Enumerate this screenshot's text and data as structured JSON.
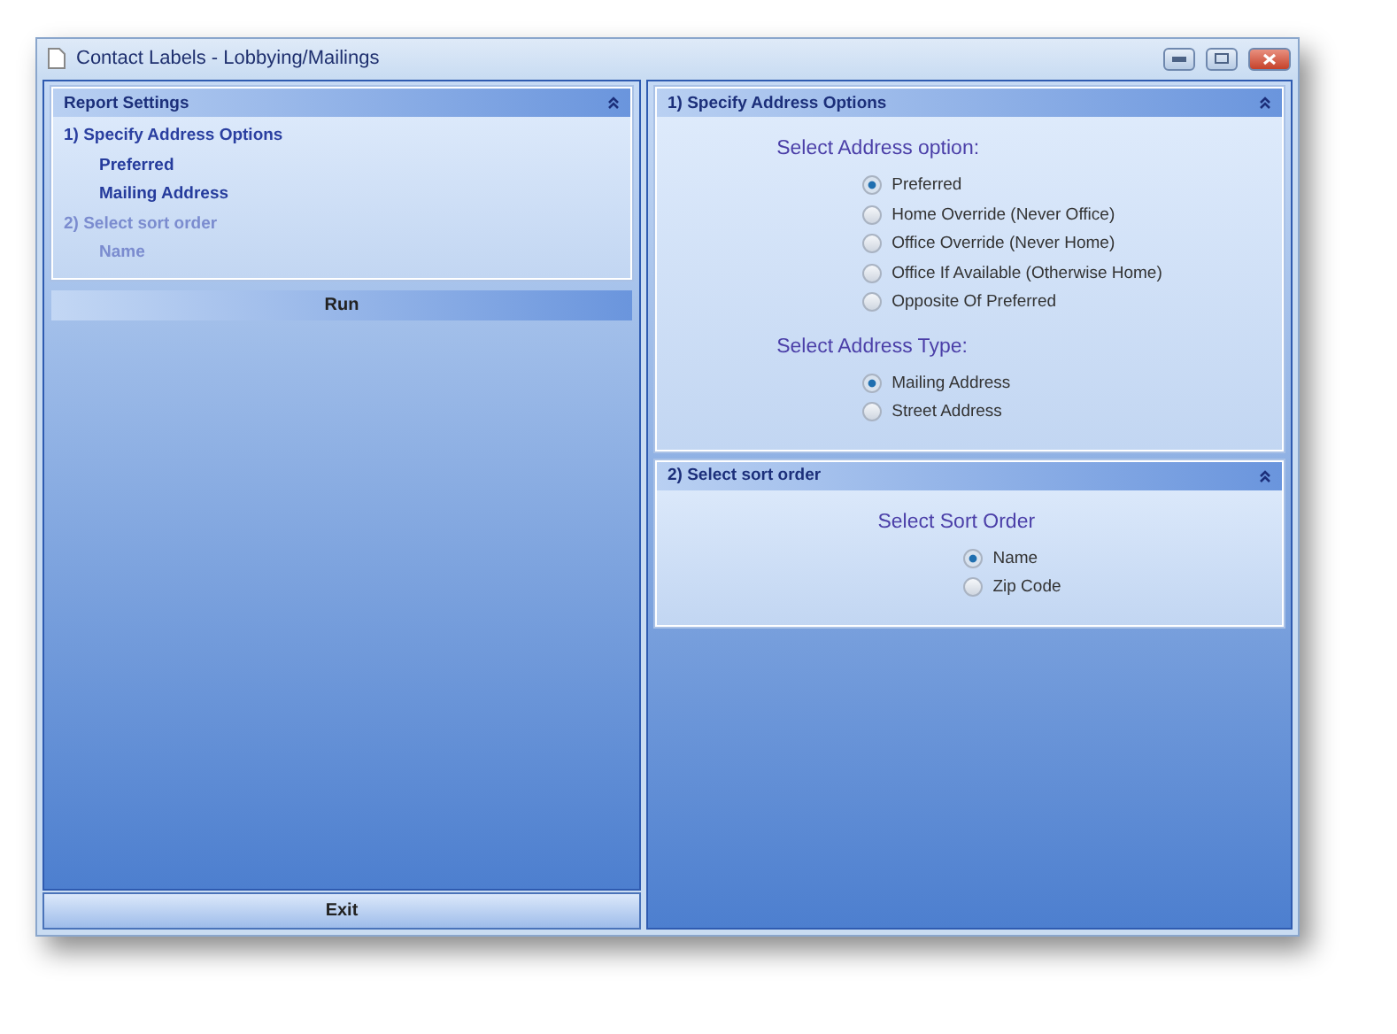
{
  "window": {
    "title": "Contact Labels - Lobbying/Mailings"
  },
  "report_settings": {
    "title": "Report Settings",
    "sections": [
      {
        "label": "1)  Specify Address Options",
        "active": true,
        "values": [
          "Preferred",
          "Mailing Address"
        ]
      },
      {
        "label": "2)  Select sort order",
        "active": false,
        "values": [
          "Name"
        ]
      }
    ],
    "run_button": "Run"
  },
  "exit_button": "Exit",
  "panels": [
    {
      "title": "1)  Specify Address Options",
      "groups": [
        {
          "heading": "Select Address option:",
          "options": [
            {
              "label": "Preferred",
              "selected": true
            },
            {
              "label": "Home Override (Never Office)",
              "selected": false
            },
            {
              "label": "Office Override (Never Home)",
              "selected": false
            },
            {
              "label": "Office If Available (Otherwise Home)",
              "selected": false
            },
            {
              "label": "Opposite Of Preferred",
              "selected": false
            }
          ]
        },
        {
          "heading": "Select Address Type:",
          "options": [
            {
              "label": "Mailing Address",
              "selected": true
            },
            {
              "label": "Street Address",
              "selected": false
            }
          ]
        }
      ]
    },
    {
      "title": "2)  Select sort order",
      "groups": [
        {
          "heading": "Select Sort Order",
          "options": [
            {
              "label": "Name",
              "selected": true
            },
            {
              "label": "Zip Code",
              "selected": false
            }
          ]
        }
      ]
    }
  ]
}
